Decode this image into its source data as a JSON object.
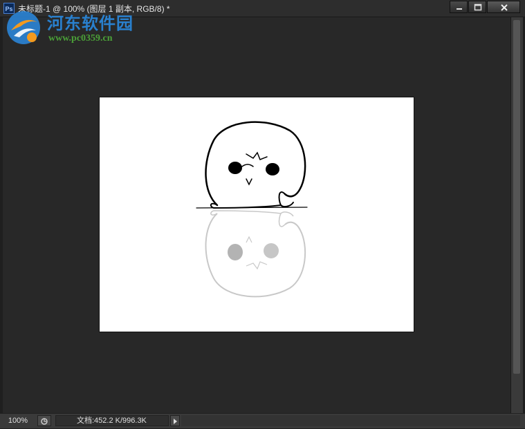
{
  "window": {
    "app_icon": "ps-icon",
    "app_icon_text": "Ps",
    "title": "未标题-1 @ 100% (图层 1 副本, RGB/8) *",
    "controls": [
      "minimize-icon",
      "maximize-icon",
      "close-icon"
    ]
  },
  "watermark": {
    "site_name": "河东软件园",
    "url": "www.pc0359.cn",
    "colors": {
      "title": "#2a8ae0",
      "url": "#4fae3a"
    }
  },
  "status": {
    "zoom": "100%",
    "doc_info": "文档:452.2 K/996.3K"
  },
  "colors": {
    "workspace": "#282828",
    "canvas": "#ffffff",
    "chrome": "#2d2d2d"
  }
}
